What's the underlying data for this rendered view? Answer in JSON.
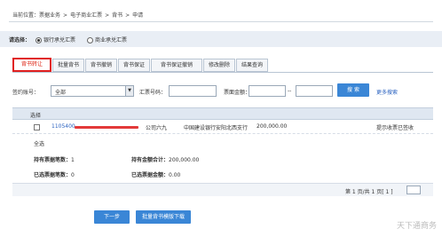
{
  "breadcrumb": {
    "prefix": "当前位置：",
    "items": [
      "票据业务",
      "电子商业汇票",
      "背书",
      "申请"
    ],
    "separator": ">"
  },
  "bill_type": {
    "label": "请选择：",
    "options": [
      {
        "label": "银行承兑汇票",
        "selected": true
      },
      {
        "label": "商业承兑汇票",
        "selected": false
      }
    ]
  },
  "tabs": [
    {
      "label": "背书转让",
      "active": true
    },
    {
      "label": "批量背书",
      "active": false
    },
    {
      "label": "背书撤销",
      "active": false
    },
    {
      "label": "背书保证",
      "active": false
    },
    {
      "label": "背书保证撤销",
      "active": false
    },
    {
      "label": "修改删除",
      "active": false
    },
    {
      "label": "结果查询",
      "active": false
    }
  ],
  "filters": {
    "account_label": "签约账号：",
    "account_value": "全部",
    "bill_no_label": "汇票号码：",
    "bill_no_value": "",
    "amount_label": "票面金额：",
    "amount_sep": "--",
    "search_button": "搜 索",
    "more_search": "更多搜索"
  },
  "table": {
    "header_select": "选择",
    "rows": [
      {
        "bill_no": "1105400",
        "payee_tail": "公司六九",
        "bank": "中国建设银行安阳北西支行",
        "amount": "200,000.00",
        "status": "提示收票已签收"
      }
    ],
    "select_all": "全选"
  },
  "summary": {
    "hold_count_label": "持有票据笔数：",
    "hold_count": "1",
    "hold_amount_label": "持有金额合计：",
    "hold_amount": "200,000.00",
    "selected_count_label": "已选票据笔数：",
    "selected_count": "0",
    "selected_amount_label": "已选票据金额：",
    "selected_amount": "0.00"
  },
  "pager": {
    "text": "第 1 页/共 1 页[ 1 ]"
  },
  "footer": {
    "next_button": "下一步",
    "batch_download_button": "批量背书模版下载"
  },
  "watermark": "天下通商务",
  "colors": {
    "accent": "#3a86d6",
    "active_tab_border": "#e02020",
    "link": "#2a62c0"
  }
}
